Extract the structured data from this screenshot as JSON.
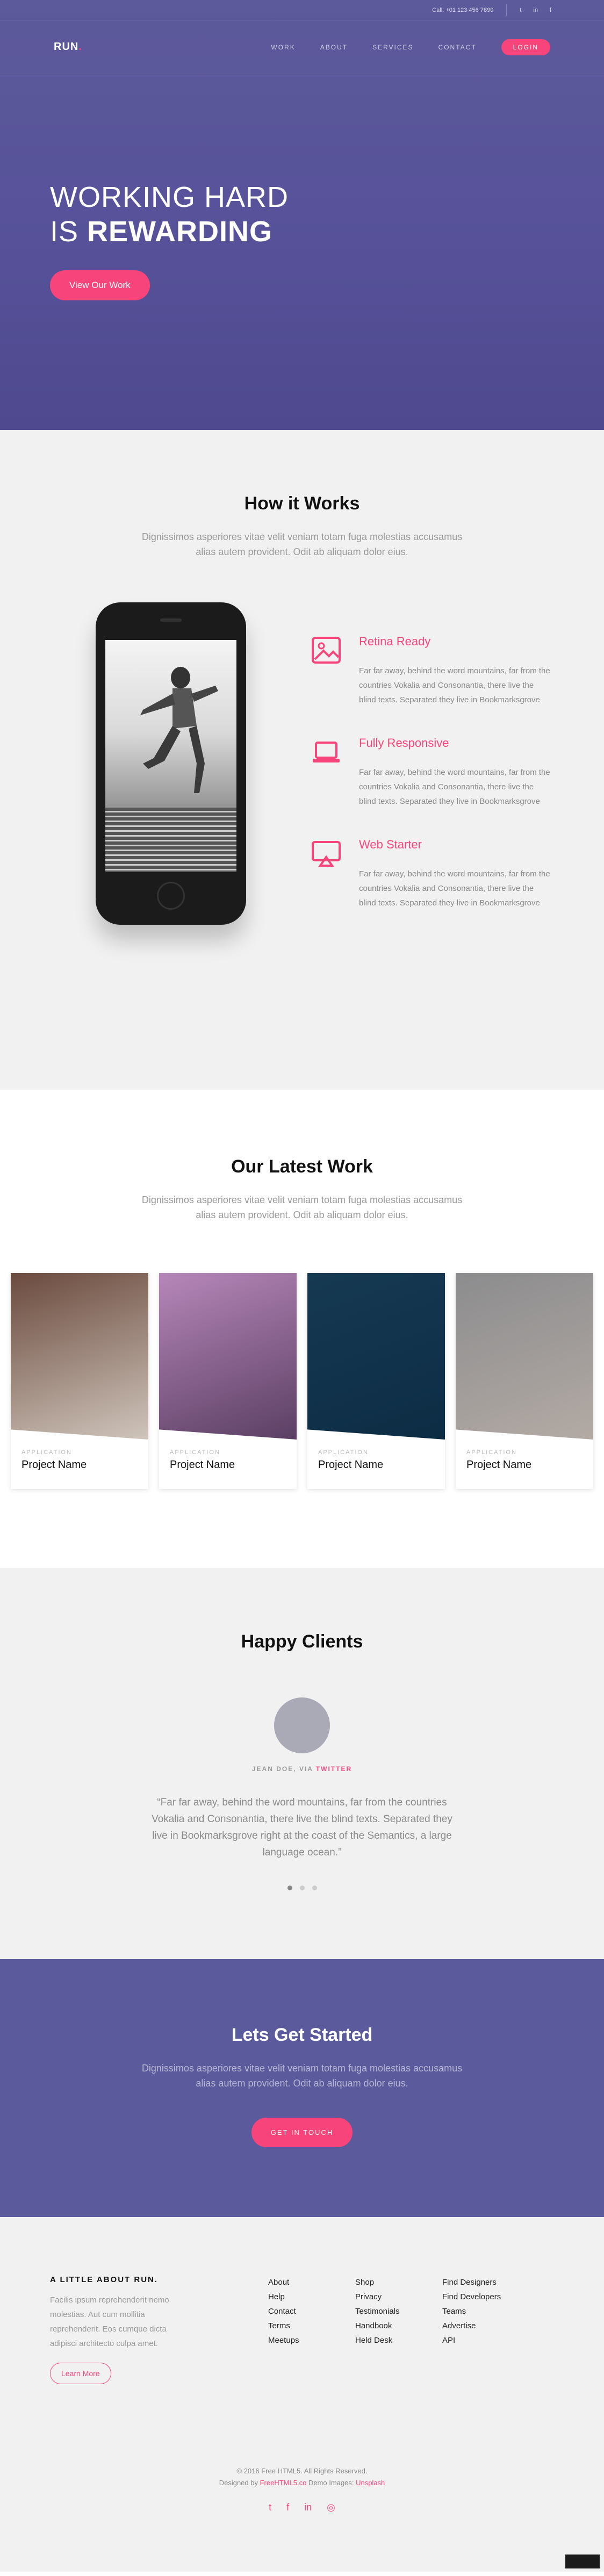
{
  "topbar": {
    "call": "Call: +01 123 456 7890",
    "social": [
      "t",
      "in",
      "f"
    ]
  },
  "nav": {
    "logo": "RUN",
    "logo_dot": ".",
    "items": [
      "WORK",
      "ABOUT",
      "SERVICES",
      "CONTACT"
    ],
    "login": "LOGIN"
  },
  "hero": {
    "line1": "WORKING HARD",
    "line2_prefix": "IS ",
    "line2_bold": "REWARDING",
    "button": "View Our Work"
  },
  "how": {
    "title": "How it Works",
    "subtitle": "Dignissimos asperiores vitae velit veniam totam fuga molestias accusamus alias autem provident. Odit ab aliquam dolor eius.",
    "features": [
      {
        "icon": "image-icon",
        "title": "Retina Ready",
        "text": "Far far away, behind the word mountains, far from the countries Vokalia and Consonantia, there live the blind texts. Separated they live in Bookmarksgrove"
      },
      {
        "icon": "laptop-icon",
        "title": "Fully Responsive",
        "text": "Far far away, behind the word mountains, far from the countries Vokalia and Consonantia, there live the blind texts. Separated they live in Bookmarksgrove"
      },
      {
        "icon": "monitor-icon",
        "title": "Web Starter",
        "text": "Far far away, behind the word mountains, far from the countries Vokalia and Consonantia, there live the blind texts. Separated they live in Bookmarksgrove"
      }
    ]
  },
  "work": {
    "title": "Our Latest Work",
    "subtitle": "Dignissimos asperiores vitae velit veniam totam fuga molestias accusamus alias autem provident. Odit ab aliquam dolor eius.",
    "cards": [
      {
        "category": "Application",
        "name": "Project Name",
        "color_top": "#6b4a3e",
        "color_bottom": "#cfc5bb"
      },
      {
        "category": "Application",
        "name": "Project Name",
        "color_top": "#b687b9",
        "color_bottom": "#5b3f63"
      },
      {
        "category": "Application",
        "name": "Project Name",
        "color_top": "#163a52",
        "color_bottom": "#0c2c44"
      },
      {
        "category": "Application",
        "name": "Project Name",
        "color_top": "#8c8c8e",
        "color_bottom": "#b3aaa4"
      }
    ]
  },
  "clients": {
    "title": "Happy Clients",
    "author": "JEAN DOE, VIA ",
    "via": "TWITTER",
    "quote": "“Far far away, behind the word mountains, far from the countries Vokalia and Consonantia, there live the blind texts. Separated they live in Bookmarksgrove right at the coast of the Semantics, a large language ocean.”"
  },
  "cta": {
    "title": "Lets Get Started",
    "subtitle": "Dignissimos asperiores vitae velit veniam totam fuga molestias accusamus alias autem provident. Odit ab aliquam dolor eius.",
    "button": "GET IN TOUCH"
  },
  "footer": {
    "about_title": "A LITTLE ABOUT RUN.",
    "about_text": "Facilis ipsum reprehenderit nemo molestias. Aut cum mollitia reprehenderit. Eos cumque dicta adipisci architecto culpa amet.",
    "learn_more": "Learn More",
    "col1": [
      "About",
      "Help",
      "Contact",
      "Terms",
      "Meetups"
    ],
    "col2": [
      "Shop",
      "Privacy",
      "Testimonials",
      "Handbook",
      "Held Desk"
    ],
    "col3": [
      "Find Designers",
      "Find Developers",
      "Teams",
      "Advertise",
      "API"
    ],
    "copyright": "© 2016 Free HTML5. All Rights Reserved.",
    "designed_prefix": "Designed by ",
    "designed_by": "FreeHTML5.co",
    "demo_prefix": " Demo Images: ",
    "demo_by": "Unsplash",
    "social": [
      "t",
      "f",
      "in",
      "◎"
    ]
  },
  "colors": {
    "accent": "#f7447a",
    "hero_bg": "#57529a",
    "cta_bg": "#5b5a9c",
    "light_bg": "#f1f1f1"
  }
}
